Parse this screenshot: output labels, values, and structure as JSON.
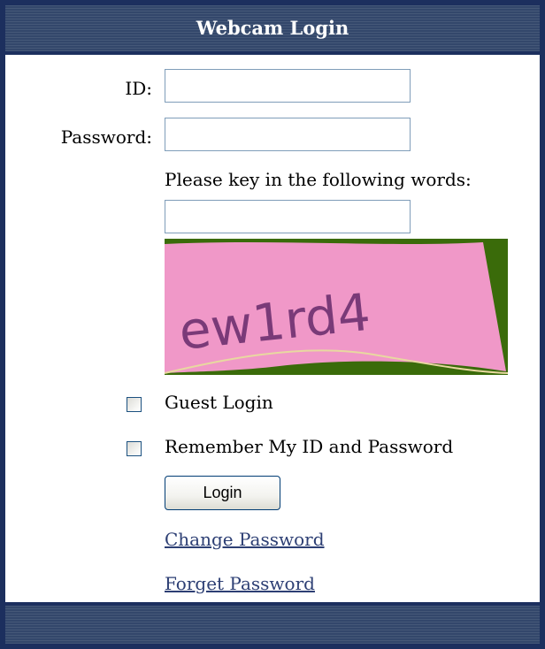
{
  "header": {
    "title": "Webcam Login"
  },
  "form": {
    "id_label": "ID:",
    "id_value": "",
    "password_label": "Password:",
    "password_value": "",
    "captcha_prompt": "Please key in the following words:",
    "captcha_value": "",
    "captcha_text": "ew1rd4",
    "guest_login_label": "Guest Login",
    "guest_login_checked": false,
    "remember_label": "Remember My ID and Password",
    "remember_checked": false,
    "login_button": "Login",
    "change_password_link": "Change Password",
    "forget_password_link": "Forget Password"
  },
  "colors": {
    "frame": "#1c2f5e",
    "header_bg": "#33476b",
    "captcha_bg": "#f098c8",
    "captcha_border": "#3a6b0a",
    "captcha_text": "#7a3a78",
    "link": "#2d3f74"
  }
}
